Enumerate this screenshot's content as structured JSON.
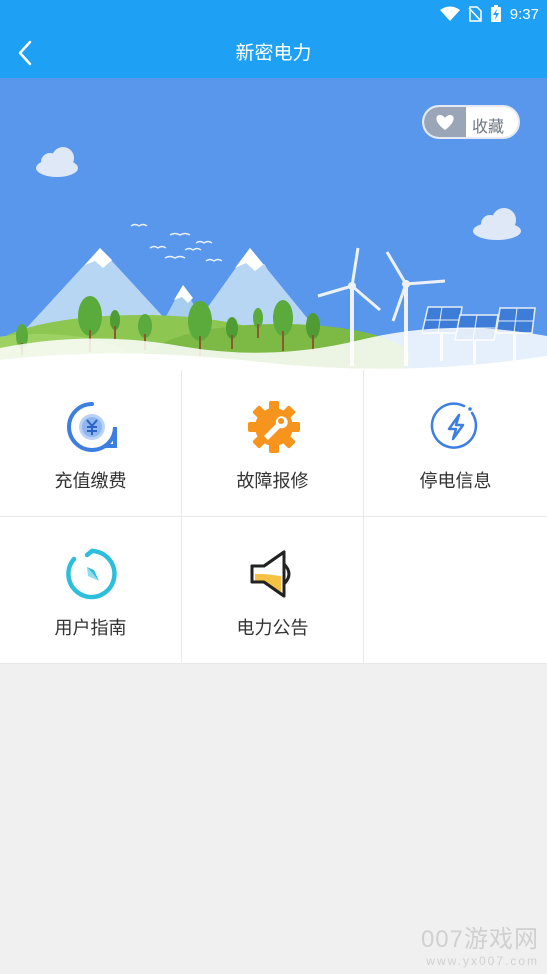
{
  "status_bar": {
    "time": "9:37"
  },
  "header": {
    "title": "新密电力"
  },
  "banner": {
    "favorite_label": "收藏"
  },
  "menu": [
    {
      "label": "充值缴费",
      "icon": "yuan-payment-icon"
    },
    {
      "label": "故障报修",
      "icon": "gear-wrench-icon"
    },
    {
      "label": "停电信息",
      "icon": "lightning-icon"
    },
    {
      "label": "用户指南",
      "icon": "compass-icon"
    },
    {
      "label": "电力公告",
      "icon": "speaker-icon"
    }
  ],
  "watermark": {
    "brand": "007游戏网",
    "url": "www.yx007.com"
  },
  "colors": {
    "header": "#1ea0f5",
    "sky": "#5897ec",
    "accent_orange": "#f7941d",
    "accent_cyan": "#2bbfdc"
  }
}
